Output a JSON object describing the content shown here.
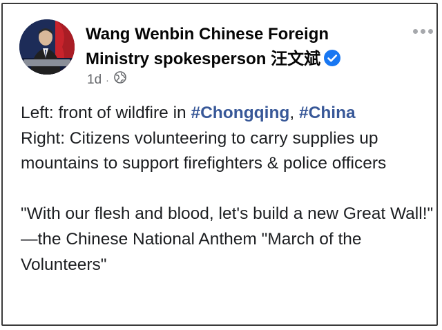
{
  "post": {
    "author": "Wang Wenbin Chinese Foreign Ministry spokesperson 汪文斌",
    "timestamp": "1d",
    "separator": "·",
    "audience_icon": "globe-icon",
    "verified_icon": "verified-badge-icon",
    "more_icon": "more-options-icon",
    "colors": {
      "hashtag": "#385898",
      "verified": "#1877f2",
      "text": "#1c1e21",
      "meta": "#65676b"
    },
    "body": {
      "line1_prefix": "Left: front of wildfire in ",
      "hashtag_chongqing": "#Chongqing",
      "comma": ", ",
      "hashtag_china": "#China",
      "line2": "Right: Citizens volunteering to carry supplies up mountains to support firefighters & police officers",
      "quote": "\"With our flesh and blood, let's build a new Great Wall!\"",
      "attribution": "—the Chinese National Anthem \"March of the Volunteers\""
    }
  }
}
